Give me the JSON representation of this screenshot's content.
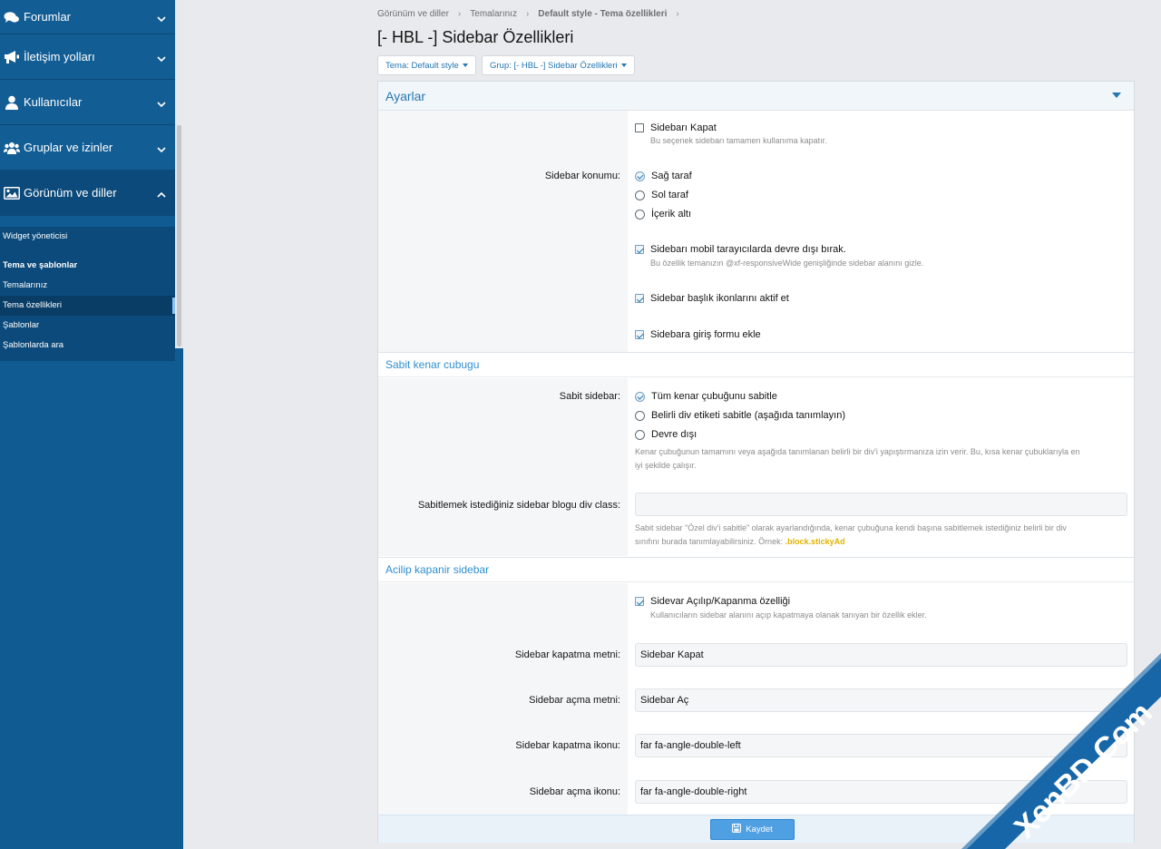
{
  "sidebar": {
    "sections": [
      {
        "label": "Forumlar",
        "icon": "comments-icon"
      },
      {
        "label": "İletişim yolları",
        "icon": "megaphone-icon"
      },
      {
        "label": "Kullanıcılar",
        "icon": "user-icon"
      },
      {
        "label": "Gruplar ve izinler",
        "icon": "users-icon"
      },
      {
        "label": "Görünüm ve diller",
        "icon": "image-icon"
      }
    ],
    "sub": {
      "widget": "Widget yöneticisi",
      "group_head": "Tema ve şablonlar",
      "items": [
        "Temalarınız",
        "Tema özellikleri",
        "Şablonlar",
        "Şablonlarda ara"
      ]
    }
  },
  "breadcrumb": [
    "Görünüm ve diller",
    "Temalarınız",
    "Default style - Tema özellikleri"
  ],
  "page_title": "[- HBL -] Sidebar Özellikleri",
  "filters": {
    "theme": "Tema: Default style",
    "group": "Grup: [- HBL -] Sidebar Özellikleri"
  },
  "panel": {
    "title": "Ayarlar",
    "general": {
      "disable": {
        "label": "Sidebarı Kapat",
        "checked": false,
        "hint": "Bu seçenek sidebarı tamamen kullanıma kapatır."
      },
      "position": {
        "label": "Sidebar konumu:",
        "options": [
          "Sağ taraf",
          "Sol taraf",
          "İçerik altı"
        ],
        "selected": 0
      },
      "mobile": {
        "label": "Sidebarı mobil tarayıcılarda devre dışı bırak.",
        "checked": true,
        "hint": "Bu özellik temanızın @xf-responsiveWide genişliğinde sidebar alanını gizle."
      },
      "icons": {
        "label": "Sidebar başlık ikonlarını aktif et",
        "checked": true
      },
      "login": {
        "label": "Sidebara giriş formu ekle",
        "checked": true
      }
    },
    "sticky": {
      "title": "Sabit kenar cubugu",
      "label": "Sabit sidebar:",
      "options": [
        "Tüm kenar çubuğunu sabitle",
        "Belirli div etiketi sabitle (aşağıda tanımlayın)",
        "Devre dışı"
      ],
      "selected": 0,
      "hint_line1": "Kenar çubuğunun tamamını veya aşağıda tanımlanan belirli bir div'i yapıştırmanıza izin verir. Bu, kısa kenar çubuklarıyla en",
      "hint_line2": "iyi şekilde çalışır.",
      "class_label": "Sabitlemek istediğiniz sidebar blogu div class:",
      "class_value": "",
      "class_hint_line1": "Sabit sidebar \"Özel div'i sabitle\" olarak ayarlandığında, kenar çubuğuna kendi başına sabitlemek istediğiniz belirli bir div",
      "class_hint_line2": "sınıfını burada tanımlayabilirsiniz. Örnek:",
      "class_example": ".block.stickyAd"
    },
    "collapse": {
      "title": "Acilip kapanir sidebar",
      "toggle": {
        "label": "Sidevar Açılıp/Kapanma özelliği",
        "checked": true,
        "hint": "Kullanıcıların sidebar alanını açıp kapatmaya olanak tanıyan bir özellik ekler."
      },
      "fields": [
        {
          "label": "Sidebar kapatma metni:",
          "value": "Sidebar Kapat"
        },
        {
          "label": "Sidebar açma metni:",
          "value": "Sidebar Aç"
        },
        {
          "label": "Sidebar kapatma ikonu:",
          "value": "far fa-angle-double-left"
        },
        {
          "label": "Sidebar açma ikonu:",
          "value": "far fa-angle-double-right"
        }
      ]
    },
    "save_label": "Kaydet"
  },
  "watermark": "XenBD.Com",
  "colors": {
    "sidebar": "#0f5b92",
    "accent": "#2577b1",
    "button": "#4f9fe3",
    "watermark": "#1767a8"
  }
}
